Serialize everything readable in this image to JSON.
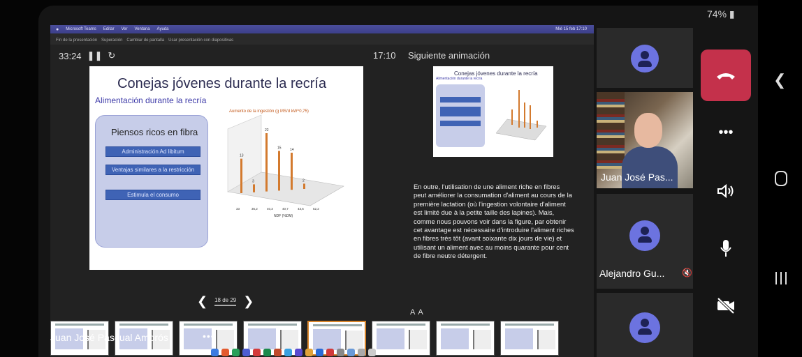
{
  "status": {
    "battery": "74%"
  },
  "mac_menubar": {
    "app": "Microsoft Teams",
    "items": [
      "Editar",
      "Ver",
      "Ventana",
      "Ayuda"
    ],
    "clock": "Mié 15 feb 17:10"
  },
  "presenter_toolbar": {
    "items": [
      "Fin de la presentación",
      "Superación",
      "Cambiar de pantalla",
      "Usar presentación con diapositivas"
    ]
  },
  "presenter": {
    "elapsed": "33:24",
    "clock": "17:10",
    "next_label": "Siguiente animación",
    "page_indicator": "18 de 29",
    "notes": "En outre, l'utilisation de une aliment riche en fibres peut améliorer la consumation d'aliment au cours de la première lactation (où l'ingestion volontaire d'aliment est limité due à la petite taille des lapines). Mais, comme nous pouvons voir dans la figure, par obtenir cet avantage est nécessaire d'introduire l'aliment riches en fibres très tôt (avant soixante dix jours de vie) et utilisant un aliment avec au moins quarante pour cent de fibre neutre détergent."
  },
  "slide": {
    "title": "Conejas jóvenes durante la recría",
    "subtitle": "Alimentación durante la recría",
    "panel_heading": "Piensos ricos en fibra",
    "buttons": [
      "Administración Ad libitum",
      "Ventajas similares a la restricción",
      "Estimula el consumo"
    ],
    "chart": {
      "title": "Aumento de la ingestión (g MS/d kW^0,75)",
      "xlabel": "NDF (%DM)"
    }
  },
  "next_slide": {
    "title": "Conejas jóvenes durante la recría",
    "subtitle": "Alimentación durante la recría"
  },
  "chart_data": {
    "type": "bar",
    "title": "Aumento de la ingestión (g MS/d kW^0,75)",
    "categories": [
      "33",
      "36,2",
      "40,3",
      "40,7",
      "43,6",
      "52,2"
    ],
    "values": [
      13,
      3,
      22,
      15,
      14,
      2
    ],
    "xlabel": "NDF (%DM)",
    "ylabel": "",
    "ylim": [
      0,
      25
    ]
  },
  "participants": {
    "presenter_name": "Juan José Pascual Amorós",
    "video_name": "Juan José Pas...",
    "muted_name": "Alejandro Gu..."
  },
  "colors": {
    "end_call": "#c4314b",
    "avatar": "#6c73e0",
    "accent_thumb": "#d9862c"
  },
  "icons": [
    "hang-up-icon",
    "more-icon",
    "speaker-icon",
    "mic-icon",
    "camera-off-icon",
    "back-icon",
    "home-icon",
    "recents-icon"
  ]
}
